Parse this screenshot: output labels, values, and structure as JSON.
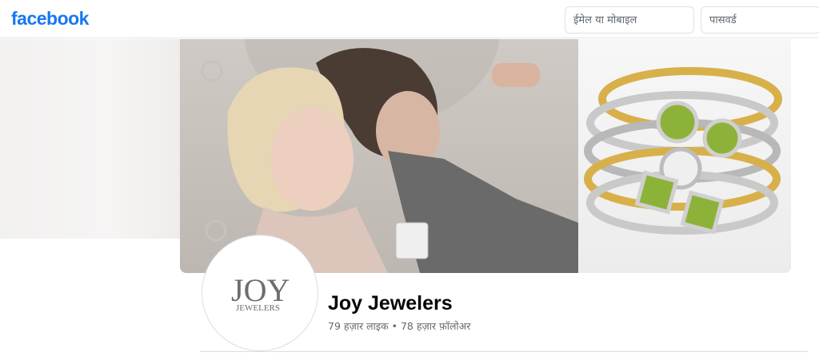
{
  "header": {
    "logo": "facebook",
    "email_placeholder": "ईमेल या मोबाइल",
    "password_placeholder": "पासवर्ड"
  },
  "page": {
    "name": "Joy Jewelers",
    "likes": "79 हज़ार लाइक",
    "separator": "•",
    "followers": "78 हज़ार फ़ॉलोअर",
    "logo_text": "JOY JEWELERS"
  },
  "colors": {
    "brand": "#1877f2",
    "text": "#050505",
    "secondary_text": "#65676b"
  }
}
